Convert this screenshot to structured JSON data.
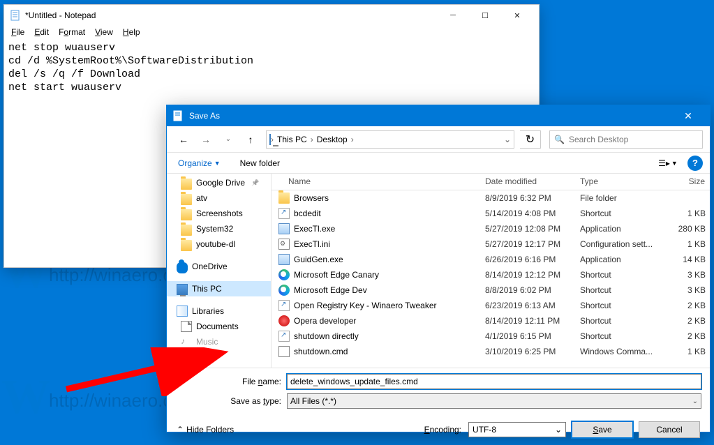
{
  "notepad": {
    "title": "*Untitled - Notepad",
    "menu": {
      "file": "File",
      "edit": "Edit",
      "format": "Format",
      "view": "View",
      "help": "Help"
    },
    "content": "net stop wuauserv\ncd /d %SystemRoot%\\SoftwareDistribution\ndel /s /q /f Download\nnet start wuauserv"
  },
  "saveas": {
    "title": "Save As",
    "nav": {
      "loc1": "This PC",
      "loc2": "Desktop"
    },
    "search_placeholder": "Search Desktop",
    "toolbar": {
      "organize": "Organize",
      "newfolder": "New folder"
    },
    "tree": {
      "gdrive": "Google Drive",
      "atv": "atv",
      "screenshots": "Screenshots",
      "system32": "System32",
      "youtubedl": "youtube-dl",
      "onedrive": "OneDrive",
      "thispc": "This PC",
      "libraries": "Libraries",
      "documents": "Documents",
      "music": "Music"
    },
    "cols": {
      "name": "Name",
      "date": "Date modified",
      "type": "Type",
      "size": "Size"
    },
    "files": [
      {
        "name": "Browsers",
        "date": "8/9/2019 6:32 PM",
        "type": "File folder",
        "size": "",
        "icon": "folder"
      },
      {
        "name": "bcdedit",
        "date": "5/14/2019 4:08 PM",
        "type": "Shortcut",
        "size": "1 KB",
        "icon": "lnk"
      },
      {
        "name": "ExecTl.exe",
        "date": "5/27/2019 12:08 PM",
        "type": "Application",
        "size": "280 KB",
        "icon": "exe"
      },
      {
        "name": "ExecTl.ini",
        "date": "5/27/2019 12:17 PM",
        "type": "Configuration sett...",
        "size": "1 KB",
        "icon": "ini"
      },
      {
        "name": "GuidGen.exe",
        "date": "6/26/2019 6:16 PM",
        "type": "Application",
        "size": "14 KB",
        "icon": "exe"
      },
      {
        "name": "Microsoft Edge Canary",
        "date": "8/14/2019 12:12 PM",
        "type": "Shortcut",
        "size": "3 KB",
        "icon": "edge"
      },
      {
        "name": "Microsoft Edge Dev",
        "date": "8/8/2019 6:02 PM",
        "type": "Shortcut",
        "size": "3 KB",
        "icon": "edge"
      },
      {
        "name": "Open Registry Key - Winaero Tweaker",
        "date": "6/23/2019 6:13 AM",
        "type": "Shortcut",
        "size": "2 KB",
        "icon": "lnk"
      },
      {
        "name": "Opera developer",
        "date": "8/14/2019 12:11 PM",
        "type": "Shortcut",
        "size": "2 KB",
        "icon": "opera"
      },
      {
        "name": "shutdown directly",
        "date": "4/1/2019 6:15 PM",
        "type": "Shortcut",
        "size": "2 KB",
        "icon": "lnk"
      },
      {
        "name": "shutdown.cmd",
        "date": "3/10/2019 6:25 PM",
        "type": "Windows Comma...",
        "size": "1 KB",
        "icon": "hand"
      }
    ],
    "fn_label": "File name:",
    "fn_value": "delete_windows_update_files.cmd",
    "type_label": "Save as type:",
    "type_value": "All Files  (*.*)",
    "hidefolders": "Hide Folders",
    "enc_label": "Encoding:",
    "enc_value": "UTF-8",
    "save": "Save",
    "cancel": "Cancel"
  },
  "watermark": "http://winaero.com"
}
